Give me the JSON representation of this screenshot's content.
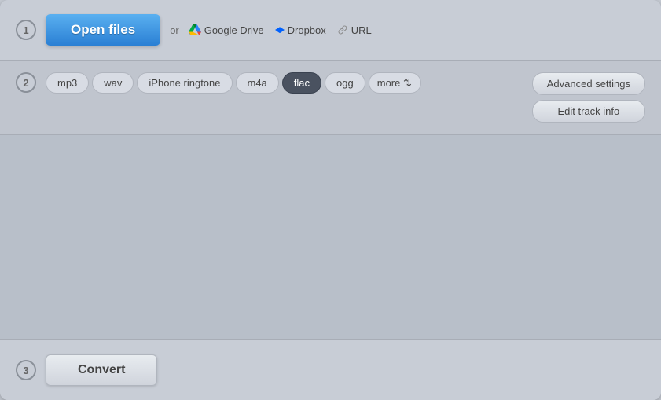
{
  "step1": {
    "badge": "1",
    "open_files_label": "Open files",
    "or_text": "or",
    "gdrive_label": "Google Drive",
    "dropbox_label": "Dropbox",
    "url_label": "URL"
  },
  "step2": {
    "badge": "2",
    "formats": [
      {
        "id": "mp3",
        "label": "mp3",
        "active": false
      },
      {
        "id": "wav",
        "label": "wav",
        "active": false
      },
      {
        "id": "iphone-ringtone",
        "label": "iPhone ringtone",
        "active": false
      },
      {
        "id": "m4a",
        "label": "m4a",
        "active": false
      },
      {
        "id": "flac",
        "label": "flac",
        "active": true
      },
      {
        "id": "ogg",
        "label": "ogg",
        "active": false
      }
    ],
    "more_label": "more",
    "advanced_settings_label": "Advanced settings",
    "edit_track_info_label": "Edit track info"
  },
  "step3": {
    "badge": "3",
    "convert_label": "Convert"
  }
}
